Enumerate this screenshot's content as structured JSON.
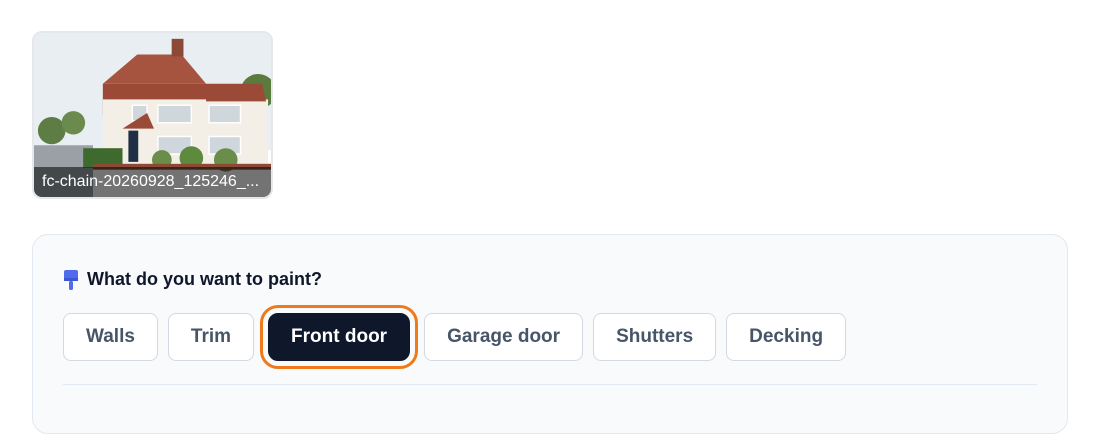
{
  "upload": {
    "filename": "fc-chain-20260928_125246_...",
    "image_icon": "house-photo"
  },
  "paint": {
    "icon": "paintbrush-icon",
    "question": "What do you want to paint?",
    "options": [
      {
        "label": "Walls",
        "selected": false
      },
      {
        "label": "Trim",
        "selected": false
      },
      {
        "label": "Front door",
        "selected": true
      },
      {
        "label": "Garage door",
        "selected": false
      },
      {
        "label": "Shutters",
        "selected": false
      },
      {
        "label": "Decking",
        "selected": false
      }
    ]
  },
  "colors": {
    "selected_bg": "#0f172a",
    "selected_outline": "#f07a1a",
    "panel_bg": "#f8fafc"
  }
}
